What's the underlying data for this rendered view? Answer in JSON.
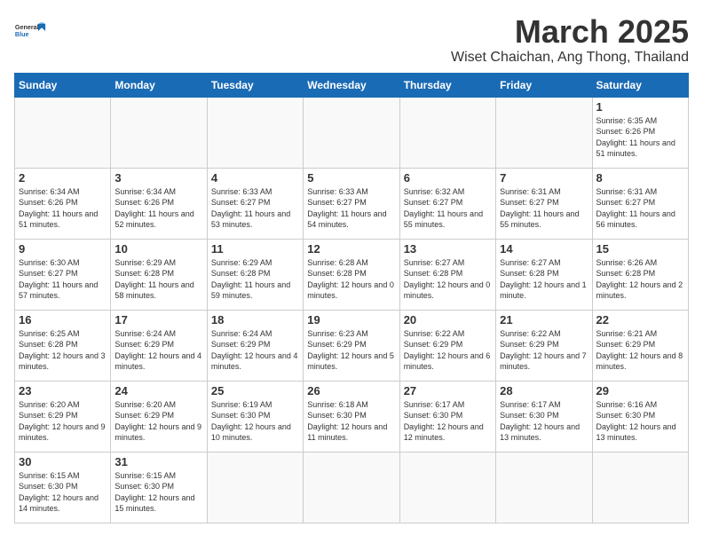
{
  "logo": {
    "general": "General",
    "blue": "Blue"
  },
  "title": "March 2025",
  "subtitle": "Wiset Chaichan, Ang Thong, Thailand",
  "days_of_week": [
    "Sunday",
    "Monday",
    "Tuesday",
    "Wednesday",
    "Thursday",
    "Friday",
    "Saturday"
  ],
  "weeks": [
    [
      {
        "day": "",
        "info": ""
      },
      {
        "day": "",
        "info": ""
      },
      {
        "day": "",
        "info": ""
      },
      {
        "day": "",
        "info": ""
      },
      {
        "day": "",
        "info": ""
      },
      {
        "day": "",
        "info": ""
      },
      {
        "day": "1",
        "info": "Sunrise: 6:35 AM\nSunset: 6:26 PM\nDaylight: 11 hours\nand 51 minutes."
      }
    ],
    [
      {
        "day": "2",
        "info": "Sunrise: 6:34 AM\nSunset: 6:26 PM\nDaylight: 11 hours\nand 51 minutes."
      },
      {
        "day": "3",
        "info": "Sunrise: 6:34 AM\nSunset: 6:26 PM\nDaylight: 11 hours\nand 52 minutes."
      },
      {
        "day": "4",
        "info": "Sunrise: 6:33 AM\nSunset: 6:27 PM\nDaylight: 11 hours\nand 53 minutes."
      },
      {
        "day": "5",
        "info": "Sunrise: 6:33 AM\nSunset: 6:27 PM\nDaylight: 11 hours\nand 54 minutes."
      },
      {
        "day": "6",
        "info": "Sunrise: 6:32 AM\nSunset: 6:27 PM\nDaylight: 11 hours\nand 55 minutes."
      },
      {
        "day": "7",
        "info": "Sunrise: 6:31 AM\nSunset: 6:27 PM\nDaylight: 11 hours\nand 55 minutes."
      },
      {
        "day": "8",
        "info": "Sunrise: 6:31 AM\nSunset: 6:27 PM\nDaylight: 11 hours\nand 56 minutes."
      }
    ],
    [
      {
        "day": "9",
        "info": "Sunrise: 6:30 AM\nSunset: 6:27 PM\nDaylight: 11 hours\nand 57 minutes."
      },
      {
        "day": "10",
        "info": "Sunrise: 6:29 AM\nSunset: 6:28 PM\nDaylight: 11 hours\nand 58 minutes."
      },
      {
        "day": "11",
        "info": "Sunrise: 6:29 AM\nSunset: 6:28 PM\nDaylight: 11 hours\nand 59 minutes."
      },
      {
        "day": "12",
        "info": "Sunrise: 6:28 AM\nSunset: 6:28 PM\nDaylight: 12 hours\nand 0 minutes."
      },
      {
        "day": "13",
        "info": "Sunrise: 6:27 AM\nSunset: 6:28 PM\nDaylight: 12 hours\nand 0 minutes."
      },
      {
        "day": "14",
        "info": "Sunrise: 6:27 AM\nSunset: 6:28 PM\nDaylight: 12 hours\nand 1 minute."
      },
      {
        "day": "15",
        "info": "Sunrise: 6:26 AM\nSunset: 6:28 PM\nDaylight: 12 hours\nand 2 minutes."
      }
    ],
    [
      {
        "day": "16",
        "info": "Sunrise: 6:25 AM\nSunset: 6:28 PM\nDaylight: 12 hours\nand 3 minutes."
      },
      {
        "day": "17",
        "info": "Sunrise: 6:24 AM\nSunset: 6:29 PM\nDaylight: 12 hours\nand 4 minutes."
      },
      {
        "day": "18",
        "info": "Sunrise: 6:24 AM\nSunset: 6:29 PM\nDaylight: 12 hours\nand 4 minutes."
      },
      {
        "day": "19",
        "info": "Sunrise: 6:23 AM\nSunset: 6:29 PM\nDaylight: 12 hours\nand 5 minutes."
      },
      {
        "day": "20",
        "info": "Sunrise: 6:22 AM\nSunset: 6:29 PM\nDaylight: 12 hours\nand 6 minutes."
      },
      {
        "day": "21",
        "info": "Sunrise: 6:22 AM\nSunset: 6:29 PM\nDaylight: 12 hours\nand 7 minutes."
      },
      {
        "day": "22",
        "info": "Sunrise: 6:21 AM\nSunset: 6:29 PM\nDaylight: 12 hours\nand 8 minutes."
      }
    ],
    [
      {
        "day": "23",
        "info": "Sunrise: 6:20 AM\nSunset: 6:29 PM\nDaylight: 12 hours\nand 9 minutes."
      },
      {
        "day": "24",
        "info": "Sunrise: 6:20 AM\nSunset: 6:29 PM\nDaylight: 12 hours\nand 9 minutes."
      },
      {
        "day": "25",
        "info": "Sunrise: 6:19 AM\nSunset: 6:30 PM\nDaylight: 12 hours\nand 10 minutes."
      },
      {
        "day": "26",
        "info": "Sunrise: 6:18 AM\nSunset: 6:30 PM\nDaylight: 12 hours\nand 11 minutes."
      },
      {
        "day": "27",
        "info": "Sunrise: 6:17 AM\nSunset: 6:30 PM\nDaylight: 12 hours\nand 12 minutes."
      },
      {
        "day": "28",
        "info": "Sunrise: 6:17 AM\nSunset: 6:30 PM\nDaylight: 12 hours\nand 13 minutes."
      },
      {
        "day": "29",
        "info": "Sunrise: 6:16 AM\nSunset: 6:30 PM\nDaylight: 12 hours\nand 13 minutes."
      }
    ],
    [
      {
        "day": "30",
        "info": "Sunrise: 6:15 AM\nSunset: 6:30 PM\nDaylight: 12 hours\nand 14 minutes."
      },
      {
        "day": "31",
        "info": "Sunrise: 6:15 AM\nSunset: 6:30 PM\nDaylight: 12 hours\nand 15 minutes."
      },
      {
        "day": "",
        "info": ""
      },
      {
        "day": "",
        "info": ""
      },
      {
        "day": "",
        "info": ""
      },
      {
        "day": "",
        "info": ""
      },
      {
        "day": "",
        "info": ""
      }
    ]
  ]
}
